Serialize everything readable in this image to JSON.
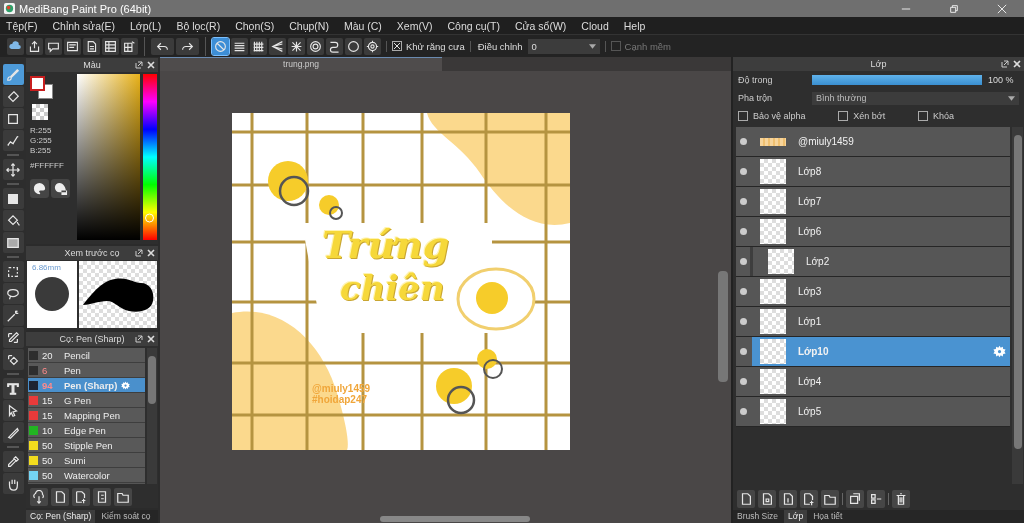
{
  "window": {
    "title": "MediBang Paint Pro (64bit)"
  },
  "menu": [
    "Tệp(F)",
    "Chỉnh sửa(E)",
    "Lớp(L)",
    "Bộ lọc(R)",
    "Chọn(S)",
    "Chụp(N)",
    "Màu (C)",
    "Xem(V)",
    "Công cụ(T)",
    "Cửa sổ(W)",
    "Cloud",
    "Help"
  ],
  "toolbar": {
    "snaps": [
      {
        "selected": true
      },
      {
        "selected": false
      },
      {
        "selected": false
      },
      {
        "selected": false
      },
      {
        "selected": false
      },
      {
        "selected": false
      },
      {
        "selected": false
      },
      {
        "selected": false
      }
    ],
    "antialias": {
      "label": "Khử răng cưa",
      "checked": true
    },
    "correction": {
      "label": "Điều chỉnh",
      "value": "0"
    },
    "soft_edge": {
      "label": "Cạnh mềm",
      "checked": false,
      "disabled": true
    }
  },
  "tools": [
    {
      "selected": true
    },
    {
      "selected": false
    },
    {
      "selected": false
    },
    {
      "selected": false
    },
    {
      "selected": false
    },
    {
      "selected": false
    },
    {
      "selected": false
    },
    {
      "selected": false
    },
    {
      "selected": false
    },
    {
      "selected": false
    },
    {
      "selected": false
    },
    {
      "selected": false
    },
    {
      "selected": false
    },
    {
      "selected": false
    },
    {
      "selected": false
    },
    {
      "selected": false
    },
    {
      "selected": false
    },
    {
      "selected": false
    }
  ],
  "color_panel": {
    "title": "Màu",
    "rgb": [
      "R:255",
      "G:255",
      "B:255"
    ],
    "hex": "#FFFFFF",
    "hue": {
      "level": 0.13
    }
  },
  "brush_preview": {
    "title": "Xem trước cọ",
    "size": "6.86mm"
  },
  "brush_panel": {
    "title": "Cọ: Pen (Sharp)",
    "items": [
      {
        "size": "20",
        "name": "Pencil",
        "color": "#2e2e2e",
        "flagged": false,
        "selected": false
      },
      {
        "size": "6",
        "name": "Pen",
        "color": "#2e2e2e",
        "flagged": true,
        "selected": false
      },
      {
        "size": "94",
        "name": "Pen (Sharp)",
        "color": "#1e2433",
        "flagged": true,
        "selected": true
      },
      {
        "size": "15",
        "name": "G Pen",
        "color": "#e83a3a",
        "flagged": false,
        "selected": false
      },
      {
        "size": "15",
        "name": "Mapping Pen",
        "color": "#e83a3a",
        "flagged": false,
        "selected": false
      },
      {
        "size": "10",
        "name": "Edge Pen",
        "color": "#22b522",
        "flagged": false,
        "selected": false
      },
      {
        "size": "50",
        "name": "Stipple Pen",
        "color": "#f2dc1e",
        "flagged": false,
        "selected": false
      },
      {
        "size": "50",
        "name": "Sumi",
        "color": "#f2dc1e",
        "flagged": false,
        "selected": false
      },
      {
        "size": "50",
        "name": "Watercolor",
        "color": "#74d4f4",
        "flagged": false,
        "selected": false
      }
    ]
  },
  "left_tabs": [
    {
      "label": "Cọ: Pen (Sharp)",
      "selected": true
    },
    {
      "label": "Kiểm soát cọ",
      "selected": false
    }
  ],
  "document": {
    "tab": "trung.png",
    "art_title": [
      "Trứng",
      "chiên"
    ],
    "art_credits": [
      "@miuly1459",
      "#hoidap247"
    ]
  },
  "layer_panel": {
    "title": "Lớp",
    "opacity": {
      "label": "Độ trong",
      "level": 1,
      "reading": "100 %"
    },
    "blend": {
      "label": "Pha trộn",
      "value": "Bình thường"
    },
    "options": [
      {
        "label": "Bảo vệ alpha",
        "checked": false
      },
      {
        "label": "Xén bớt",
        "checked": false
      },
      {
        "label": "Khóa",
        "checked": false
      }
    ],
    "layers": [
      {
        "name": "@miuly1459",
        "selected": false,
        "clipped": false
      },
      {
        "name": "Lớp8",
        "selected": false,
        "clipped": false
      },
      {
        "name": "Lớp7",
        "selected": false,
        "clipped": false
      },
      {
        "name": "Lớp6",
        "selected": false,
        "clipped": false
      },
      {
        "name": "Lớp2",
        "selected": false,
        "clipped": true
      },
      {
        "name": "Lớp3",
        "selected": false,
        "clipped": false
      },
      {
        "name": "Lớp1",
        "selected": false,
        "clipped": false
      },
      {
        "name": "Lớp10",
        "selected": true,
        "clipped": false
      },
      {
        "name": "Lớp4",
        "selected": false,
        "clipped": false
      },
      {
        "name": "Lớp5",
        "selected": false,
        "clipped": false
      }
    ]
  },
  "right_tabs": [
    {
      "label": "Brush Size",
      "selected": false
    },
    {
      "label": "Lớp",
      "selected": true
    },
    {
      "label": "Họa tiết",
      "selected": false
    }
  ]
}
